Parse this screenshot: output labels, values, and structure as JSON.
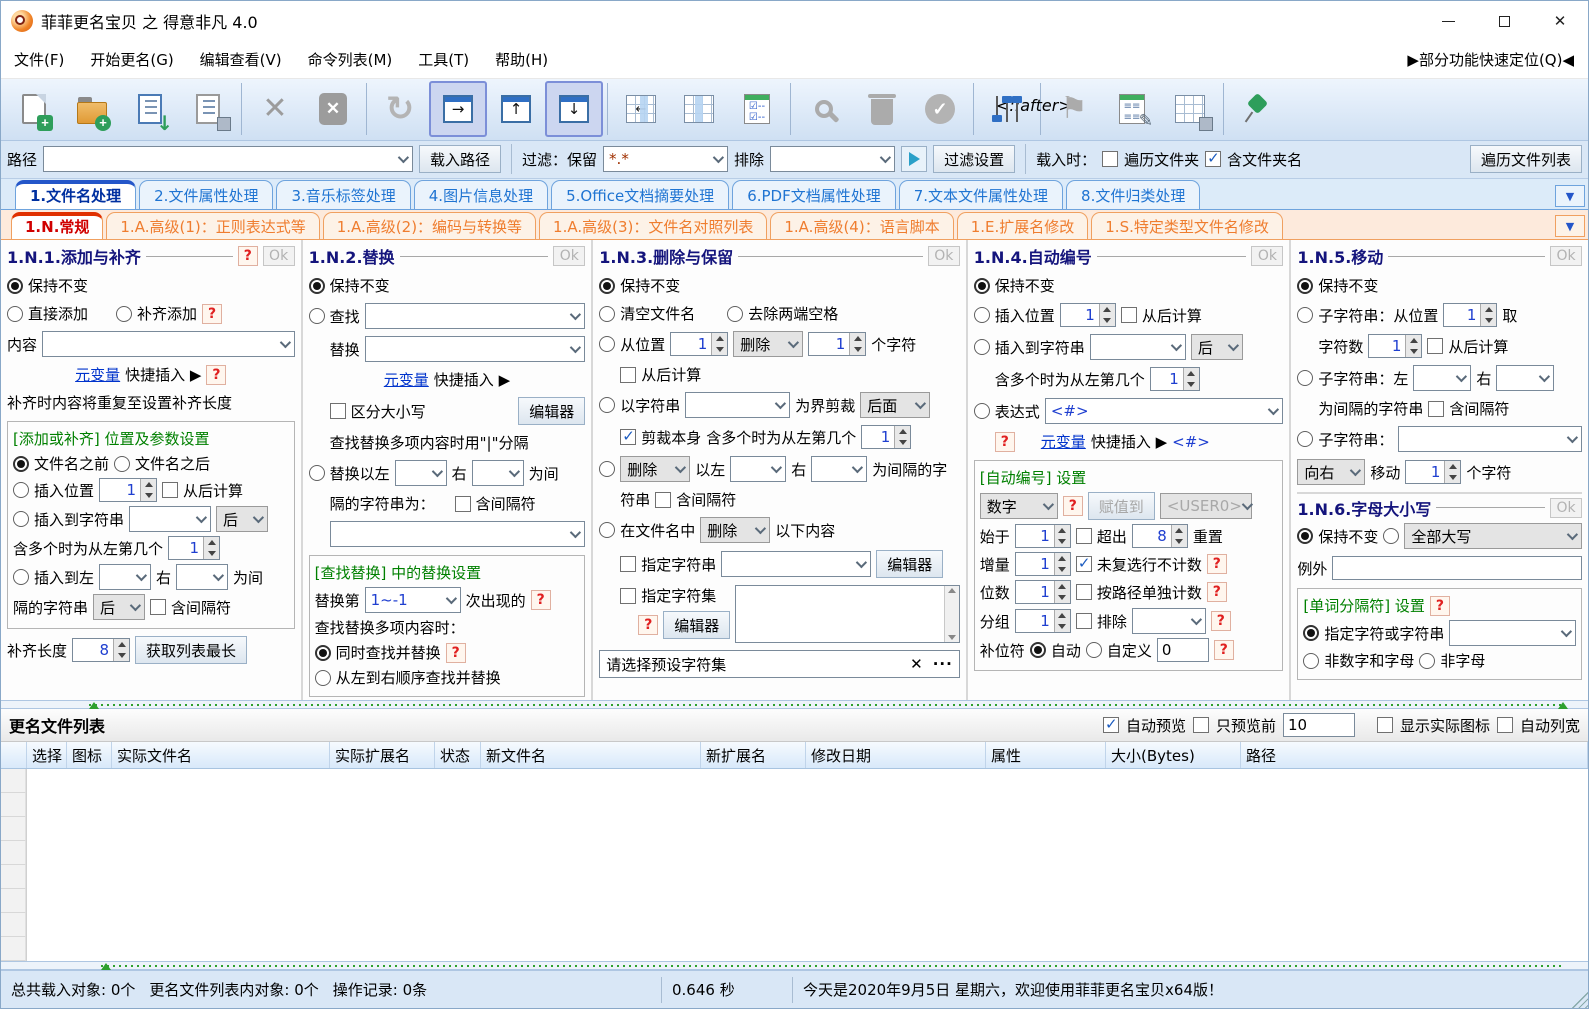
{
  "window": {
    "title": "菲菲更名宝贝 之 得意非凡 4.0"
  },
  "menu": {
    "items": [
      "文件(F)",
      "开始更名(G)",
      "编辑查看(V)",
      "命令列表(M)",
      "工具(T)",
      "帮助(H)"
    ],
    "quick_locate": "▶部分功能快速定位(Q)◀"
  },
  "pathbar": {
    "path_label": "路径",
    "load_path_btn": "载入路径",
    "filter_label": "过滤：保留",
    "keep_value": "*.*",
    "exclude_label": "排除",
    "filter_settings_btn": "过滤设置",
    "load_when_label": "载入时：",
    "traverse_folders": "遍历文件夹",
    "include_folder_name": "含文件夹名",
    "traverse_list_btn": "遍历文件列表"
  },
  "tabs_main": [
    {
      "label": "1.文件名处理"
    },
    {
      "label": "2.文件属性处理"
    },
    {
      "label": "3.音乐标签处理"
    },
    {
      "label": "4.图片信息处理"
    },
    {
      "label": "5.Office文档摘要处理"
    },
    {
      "label": "6.PDF文档属性处理"
    },
    {
      "label": "7.文本文件属性处理"
    },
    {
      "label": "8.文件归类处理"
    }
  ],
  "tabs_sub": [
    {
      "label": "1.N.常规"
    },
    {
      "label": "1.A.高级(1)：正则表达式等"
    },
    {
      "label": "1.A.高级(2)：编码与转换等"
    },
    {
      "label": "1.A.高级(3)：文件名对照列表"
    },
    {
      "label": "1.A.高级(4)：语言脚本"
    },
    {
      "label": "1.E.扩展名修改"
    },
    {
      "label": "1.S.特定类型文件名修改"
    }
  ],
  "p1": {
    "title": "1.N.1.添加与补齐",
    "q": "?",
    "ok": "Ok",
    "keep": "保持不变",
    "direct_add": "直接添加",
    "pad_add": "补齐添加",
    "content_label": "内容",
    "metavar_link": "元变量",
    "quick_insert": "快捷插入 ▶",
    "note": "补齐时内容将重复至设置补齐长度",
    "group_title": "[添加或补齐] 位置及参数设置",
    "before_name": "文件名之前",
    "after_name": "文件名之后",
    "insert_pos": "插入位置",
    "insert_pos_val": "1",
    "from_end": "从后计算",
    "insert_to_str": "插入到字符串",
    "pos_after": "后",
    "multi_label": "含多个时为从左第几个",
    "multi_val": "1",
    "insert_left": "插入到左",
    "right_label": "右",
    "wei_jian": "为间",
    "sep_line": "隔的字符串",
    "sep_after": "后",
    "incl_sep": "含间隔符",
    "pad_len": "补齐长度",
    "pad_len_val": "8",
    "get_longest_btn": "获取列表最长"
  },
  "p2": {
    "title": "1.N.2.替换",
    "ok": "Ok",
    "keep": "保持不变",
    "find": "查找",
    "replace": "替换",
    "metavar_link": "元变量",
    "quick_insert": "快捷插入 ▶",
    "case_sensitive": "区分大小写",
    "editor_btn": "编辑器",
    "sep_note": "查找替换多项内容时用\"|\"分隔",
    "replace_between": "替换以左",
    "right_label": "右",
    "wei_jian": "为间",
    "sep_line": "隔的字符串为：",
    "incl_sep": "含间隔符",
    "group_title": "[查找替换] 中的替换设置",
    "replace_nth": "替换第",
    "nth_val": "1~-1",
    "occurrence": "次出现的",
    "q": "?",
    "multi_title": "查找替换多项内容时：",
    "simultaneous": "同时查找并替换",
    "sequential": "从左到右顺序查找并替换"
  },
  "p3": {
    "title": "1.N.3.删除与保留",
    "ok": "Ok",
    "keep": "保持不变",
    "clear_name": "清空文件名",
    "trim_spaces": "去除两端空格",
    "from_pos": "从位置",
    "pos_val": "1",
    "del_opt": "删除",
    "count_val": "1",
    "chars_suffix": "个字符",
    "from_end": "从后计算",
    "by_string": "以字符串",
    "cut_boundary": "为界剪裁",
    "back_opt": "后面",
    "cut_self": "剪裁本身",
    "multi_label": "含多个时为从左第几个",
    "multi_val": "1",
    "del_opt2": "删除",
    "between_left": "以左",
    "right_label": "右",
    "between_suffix": "为间隔的字",
    "str_line": "符串",
    "incl_sep": "含间隔符",
    "in_name": "在文件名中",
    "del_opt3": "删除",
    "following": "以下内容",
    "spec_string": "指定字符串",
    "editor_btn": "编辑器",
    "spec_charset": "指定字符集",
    "q": "?",
    "editor_btn2": "编辑器",
    "preset_placeholder": "请选择预设字符集",
    "clear_x": "✕",
    "more_dots": "···"
  },
  "p4": {
    "title": "1.N.4.自动编号",
    "ok": "Ok",
    "keep": "保持不变",
    "insert_pos": "插入位置",
    "pos_val": "1",
    "from_end": "从后计算",
    "insert_to_str": "插入到字符串",
    "pos_after": "后",
    "multi_label": "含多个时为从左第几个",
    "multi_val": "1",
    "expression": "表达式",
    "expr_val": "<#>",
    "q": "?",
    "metavar_link": "元变量",
    "quick_insert": "快捷插入 ▶",
    "expr_tag": "<#>",
    "group_title": "[自动编号] 设置",
    "type_val": "数字",
    "assign_btn": "赋值到",
    "assign_target": "<USER0>",
    "start_label": "始于",
    "start_val": "1",
    "over_label": "超出",
    "over_val": "8",
    "reset_label": "重置",
    "inc_label": "增量",
    "inc_val": "1",
    "skip_unchecked": "未复选行不计数",
    "digits_label": "位数",
    "digits_val": "1",
    "per_path": "按路径单独计数",
    "group_label": "分组",
    "group_val": "1",
    "exclude_label": "排除",
    "pad_label": "补位符",
    "auto_label": "自动",
    "custom_label": "自定义",
    "custom_val": "0"
  },
  "p5": {
    "title": "1.N.5.移动",
    "ok": "Ok",
    "keep": "保持不变",
    "sub1": "子字符串：从位置",
    "sub1_val": "1",
    "take": "取",
    "char_count": "字符数",
    "count_val": "1",
    "from_end": "从后计算",
    "sub2": "子字符串：左",
    "right_label": "右",
    "sep_line": "为间隔的字符串",
    "incl_sep": "含间隔符",
    "sub3": "子字符串：",
    "dir_val": "向右",
    "move_label": "移动",
    "move_val": "1",
    "chars_suffix": "个字符"
  },
  "p6": {
    "title": "1.N.6.字母大小写",
    "ok": "Ok",
    "keep": "保持不变",
    "case_val": "全部大写",
    "except_label": "例外",
    "group_title": "[单词分隔符] 设置",
    "q": "?",
    "spec_chars": "指定字符或字符串",
    "non_alnum": "非数字和字母",
    "non_alpha": "非字母"
  },
  "filelist": {
    "title": "更名文件列表",
    "auto_preview": "自动预览",
    "preview_first": "只预览前",
    "preview_count": "10",
    "show_icons": "显示实际图标",
    "auto_width": "自动列宽",
    "columns": [
      "选择",
      "图标",
      "实际文件名",
      "实际扩展名",
      "状态",
      "新文件名",
      "新扩展名",
      "修改日期",
      "属性",
      "大小(Bytes)",
      "路径"
    ]
  },
  "statusbar": {
    "loaded": "总共载入对象: 0个",
    "in_list": "更名文件列表内对象: 0个",
    "records": "操作记录: 0条",
    "time": "0.646 秒",
    "welcome": "今天是2020年9月5日 星期六，欢迎使用菲菲更名宝贝x64版！"
  },
  "colors": {
    "accent_blue": "#2f6fc4",
    "accent_orange": "#f07a2a",
    "accent_red": "#d00000",
    "green": "#008000",
    "link_blue": "#0033cc"
  }
}
